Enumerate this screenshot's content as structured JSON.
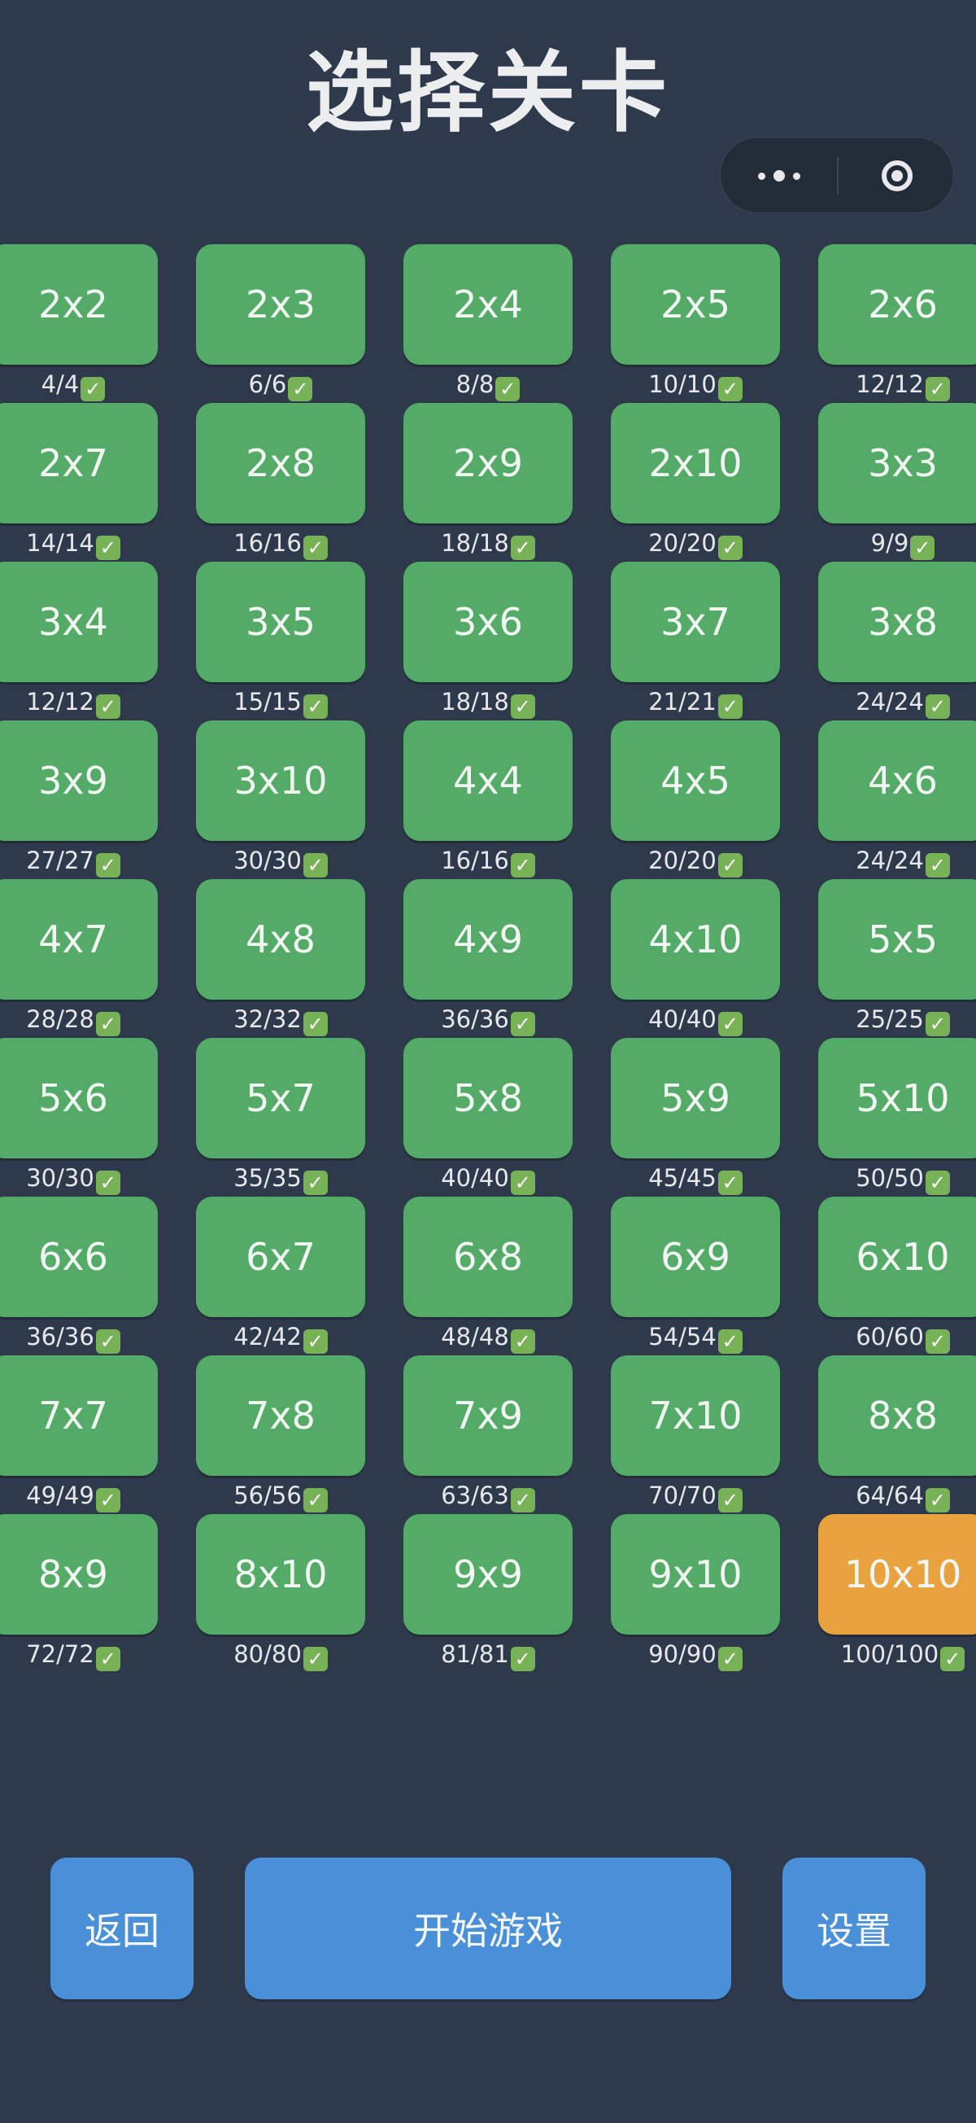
{
  "title": "选择关卡",
  "capsule": {
    "more_icon": "more-dots-icon",
    "close_icon": "target-circle-icon"
  },
  "levels": [
    {
      "label": "2x2",
      "progress": "4/4",
      "state": "done"
    },
    {
      "label": "2x3",
      "progress": "6/6",
      "state": "done"
    },
    {
      "label": "2x4",
      "progress": "8/8",
      "state": "done"
    },
    {
      "label": "2x5",
      "progress": "10/10",
      "state": "done"
    },
    {
      "label": "2x6",
      "progress": "12/12",
      "state": "done"
    },
    {
      "label": "2x7",
      "progress": "14/14",
      "state": "done"
    },
    {
      "label": "2x8",
      "progress": "16/16",
      "state": "done"
    },
    {
      "label": "2x9",
      "progress": "18/18",
      "state": "done"
    },
    {
      "label": "2x10",
      "progress": "20/20",
      "state": "done"
    },
    {
      "label": "3x3",
      "progress": "9/9",
      "state": "done"
    },
    {
      "label": "3x4",
      "progress": "12/12",
      "state": "done"
    },
    {
      "label": "3x5",
      "progress": "15/15",
      "state": "done"
    },
    {
      "label": "3x6",
      "progress": "18/18",
      "state": "done"
    },
    {
      "label": "3x7",
      "progress": "21/21",
      "state": "done"
    },
    {
      "label": "3x8",
      "progress": "24/24",
      "state": "done"
    },
    {
      "label": "3x9",
      "progress": "27/27",
      "state": "done"
    },
    {
      "label": "3x10",
      "progress": "30/30",
      "state": "done"
    },
    {
      "label": "4x4",
      "progress": "16/16",
      "state": "done"
    },
    {
      "label": "4x5",
      "progress": "20/20",
      "state": "done"
    },
    {
      "label": "4x6",
      "progress": "24/24",
      "state": "done"
    },
    {
      "label": "4x7",
      "progress": "28/28",
      "state": "done"
    },
    {
      "label": "4x8",
      "progress": "32/32",
      "state": "done"
    },
    {
      "label": "4x9",
      "progress": "36/36",
      "state": "done"
    },
    {
      "label": "4x10",
      "progress": "40/40",
      "state": "done"
    },
    {
      "label": "5x5",
      "progress": "25/25",
      "state": "done"
    },
    {
      "label": "5x6",
      "progress": "30/30",
      "state": "done"
    },
    {
      "label": "5x7",
      "progress": "35/35",
      "state": "done"
    },
    {
      "label": "5x8",
      "progress": "40/40",
      "state": "done"
    },
    {
      "label": "5x9",
      "progress": "45/45",
      "state": "done"
    },
    {
      "label": "5x10",
      "progress": "50/50",
      "state": "done"
    },
    {
      "label": "6x6",
      "progress": "36/36",
      "state": "done"
    },
    {
      "label": "6x7",
      "progress": "42/42",
      "state": "done"
    },
    {
      "label": "6x8",
      "progress": "48/48",
      "state": "done"
    },
    {
      "label": "6x9",
      "progress": "54/54",
      "state": "done"
    },
    {
      "label": "6x10",
      "progress": "60/60",
      "state": "done"
    },
    {
      "label": "7x7",
      "progress": "49/49",
      "state": "done"
    },
    {
      "label": "7x8",
      "progress": "56/56",
      "state": "done"
    },
    {
      "label": "7x9",
      "progress": "63/63",
      "state": "done"
    },
    {
      "label": "7x10",
      "progress": "70/70",
      "state": "done"
    },
    {
      "label": "8x8",
      "progress": "64/64",
      "state": "done"
    },
    {
      "label": "8x9",
      "progress": "72/72",
      "state": "done"
    },
    {
      "label": "8x10",
      "progress": "80/80",
      "state": "done"
    },
    {
      "label": "9x9",
      "progress": "81/81",
      "state": "done"
    },
    {
      "label": "9x10",
      "progress": "90/90",
      "state": "done"
    },
    {
      "label": "10x10",
      "progress": "100/100",
      "state": "current"
    }
  ],
  "check_glyph": "✓",
  "colors": {
    "background": "#2e3a4b",
    "tile_done": "#54ab67",
    "tile_current": "#e8a23e",
    "button": "#4a90d9"
  },
  "buttons": {
    "back": "返回",
    "start": "开始游戏",
    "settings": "设置"
  }
}
